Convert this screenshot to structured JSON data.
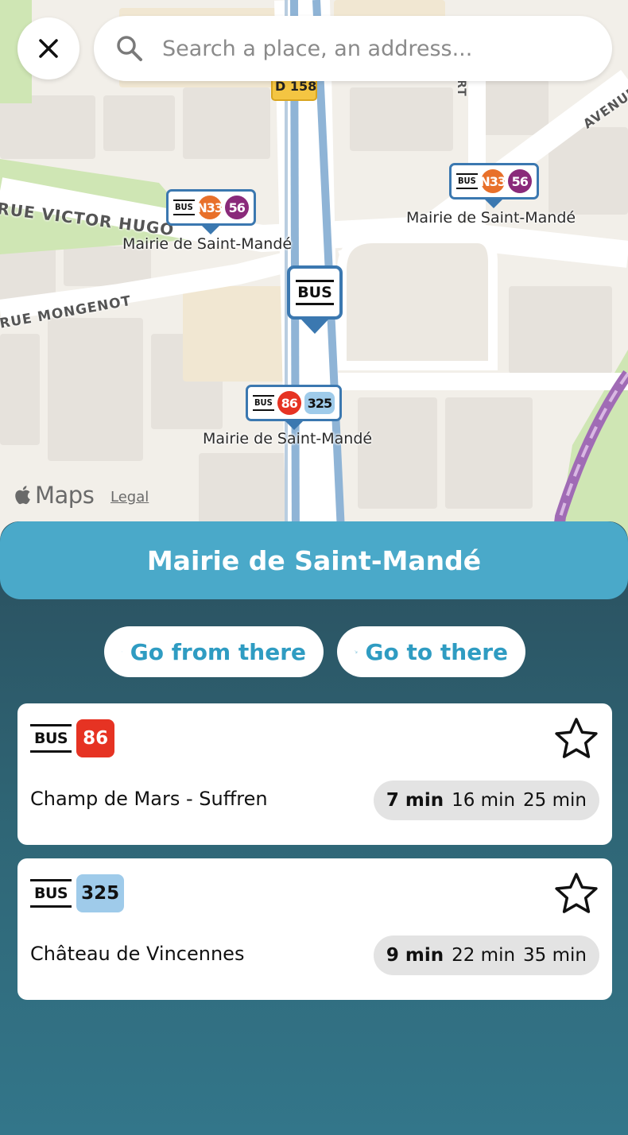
{
  "search": {
    "placeholder": "Search a place, an address..."
  },
  "map": {
    "road_badge": "D 158",
    "streets": {
      "victor_hugo": "RUE VICTOR HUGO",
      "mongenot": "RUE MONGENOT",
      "avenue": "AVENUE",
      "rt": "RT"
    },
    "pins": [
      {
        "stop": "Mairie de Saint-Mandé",
        "bus": "BUS",
        "lines": [
          {
            "label": "N33",
            "color": "#e8702a"
          },
          {
            "label": "56",
            "color": "#8a2a7a"
          }
        ]
      },
      {
        "stop": "Mairie de Saint-Mandé",
        "bus": "BUS",
        "lines": [
          {
            "label": "N33",
            "color": "#e8702a"
          },
          {
            "label": "56",
            "color": "#8a2a7a"
          }
        ]
      },
      {
        "stop": "Mairie de Saint-Mandé",
        "bus": "BUS",
        "lines": [
          {
            "label": "86",
            "color": "#e63323"
          },
          {
            "label": "325",
            "color": "#9fcbea"
          }
        ]
      }
    ],
    "selected_pin": {
      "bus": "BUS"
    },
    "attribution": {
      "maps": "Maps",
      "legal": "Legal"
    }
  },
  "sheet": {
    "stop_name": "Mairie de Saint-Mandé",
    "go_from": "Go from there",
    "go_to": "Go to there",
    "departures": [
      {
        "bus": "BUS",
        "line": "86",
        "line_color": "#e63323",
        "line_text_color": "#ffffff",
        "destination": "Champ de Mars - Suffren",
        "times": [
          "7 min",
          "16 min",
          "25 min"
        ],
        "starred": false
      },
      {
        "bus": "BUS",
        "line": "325",
        "line_color": "#9fcbea",
        "line_text_color": "#111111",
        "destination": "Château de Vincennes",
        "times": [
          "9 min",
          "22 min",
          "35 min"
        ],
        "starred": false
      }
    ]
  },
  "colors": {
    "accent": "#4aa9c9",
    "pin_border": "#3b78b0",
    "link": "#2f9cc2"
  }
}
